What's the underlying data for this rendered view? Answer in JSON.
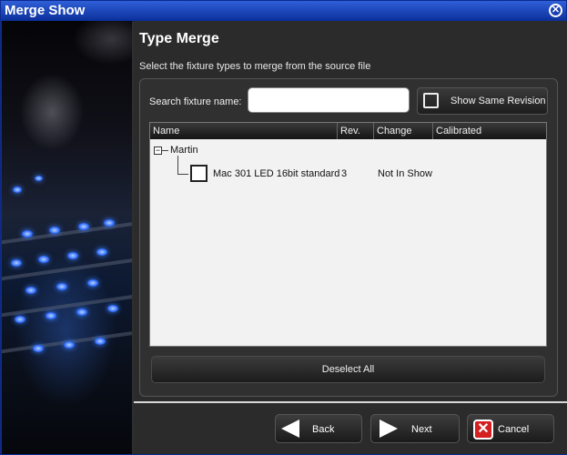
{
  "window": {
    "title": "Merge Show"
  },
  "header": {
    "heading": "Type Merge",
    "subtitle": "Select the fixture types to merge from the source file"
  },
  "search": {
    "label": "Search fixture name:",
    "value": "",
    "placeholder": ""
  },
  "revision_toggle": {
    "label": "Show Same Revision",
    "checked": false
  },
  "list": {
    "columns": [
      "Name",
      "Rev.",
      "Change",
      "Calibrated"
    ],
    "groups": [
      {
        "name": "Martin",
        "expanded": true,
        "rows": [
          {
            "name": "Mac 301 LED 16bit standard",
            "rev": "3",
            "change": "Not In Show",
            "calibrated": "",
            "checked": false
          }
        ]
      }
    ]
  },
  "actions": {
    "deselect_all": "Deselect All",
    "back": "Back",
    "next": "Next",
    "cancel": "Cancel"
  },
  "colors": {
    "title_bar": "#1a46c4",
    "panel": "#2b2b2b",
    "cancel_icon": "#d42020"
  }
}
